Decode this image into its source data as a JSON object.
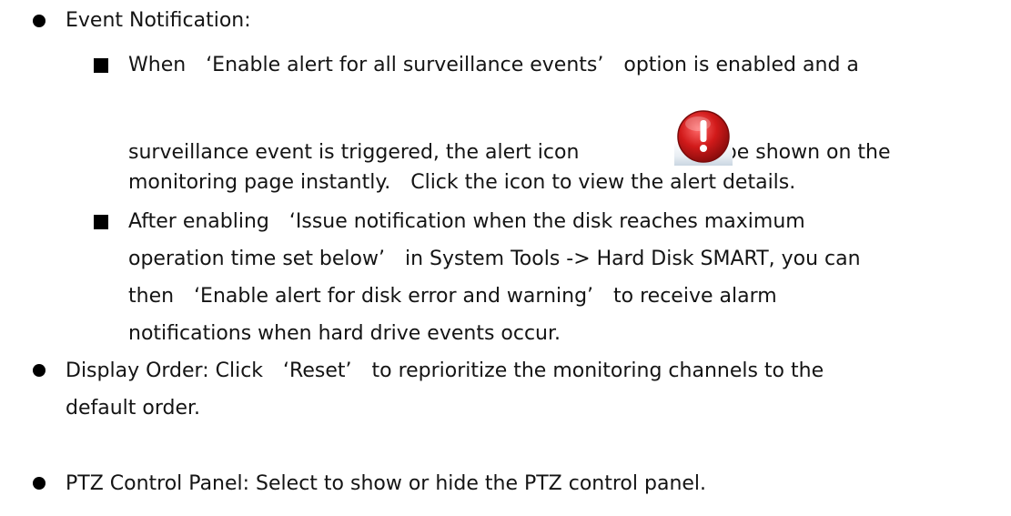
{
  "items": [
    {
      "label": "Event Notification:",
      "sub_items": [
        {
          "lines": [
            {
              "before": "When",
              "quote": "‘Enable alert for all surveillance events’",
              "after": "option is enabled and a"
            },
            {
              "before": "surveillance event is triggered, the alert icon",
              "after": "will be shown on the"
            },
            {
              "text": "monitoring page instantly.",
              "text2": "Click the icon to view the alert details."
            }
          ]
        },
        {
          "lines": [
            {
              "before": "After enabling",
              "quote": "‘Issue notification when the disk reaches maximum"
            },
            {
              "quote_end": "operation time set below’",
              "after": "in System Tools -> Hard Disk SMART, you can"
            },
            {
              "before": "then",
              "quote": "‘Enable alert for disk error and warning’",
              "after": "to receive alarm"
            },
            {
              "text": "notifications when hard drive events occur."
            }
          ]
        }
      ]
    },
    {
      "before": "Display Order: Click",
      "quote": "‘Reset’",
      "after": "to reprioritize the monitoring channels to the",
      "line2": "default order."
    },
    {
      "text": "PTZ Control Panel: Select to show or hide the PTZ control panel."
    }
  ],
  "icons": {
    "alert_icon": "alert-icon"
  }
}
